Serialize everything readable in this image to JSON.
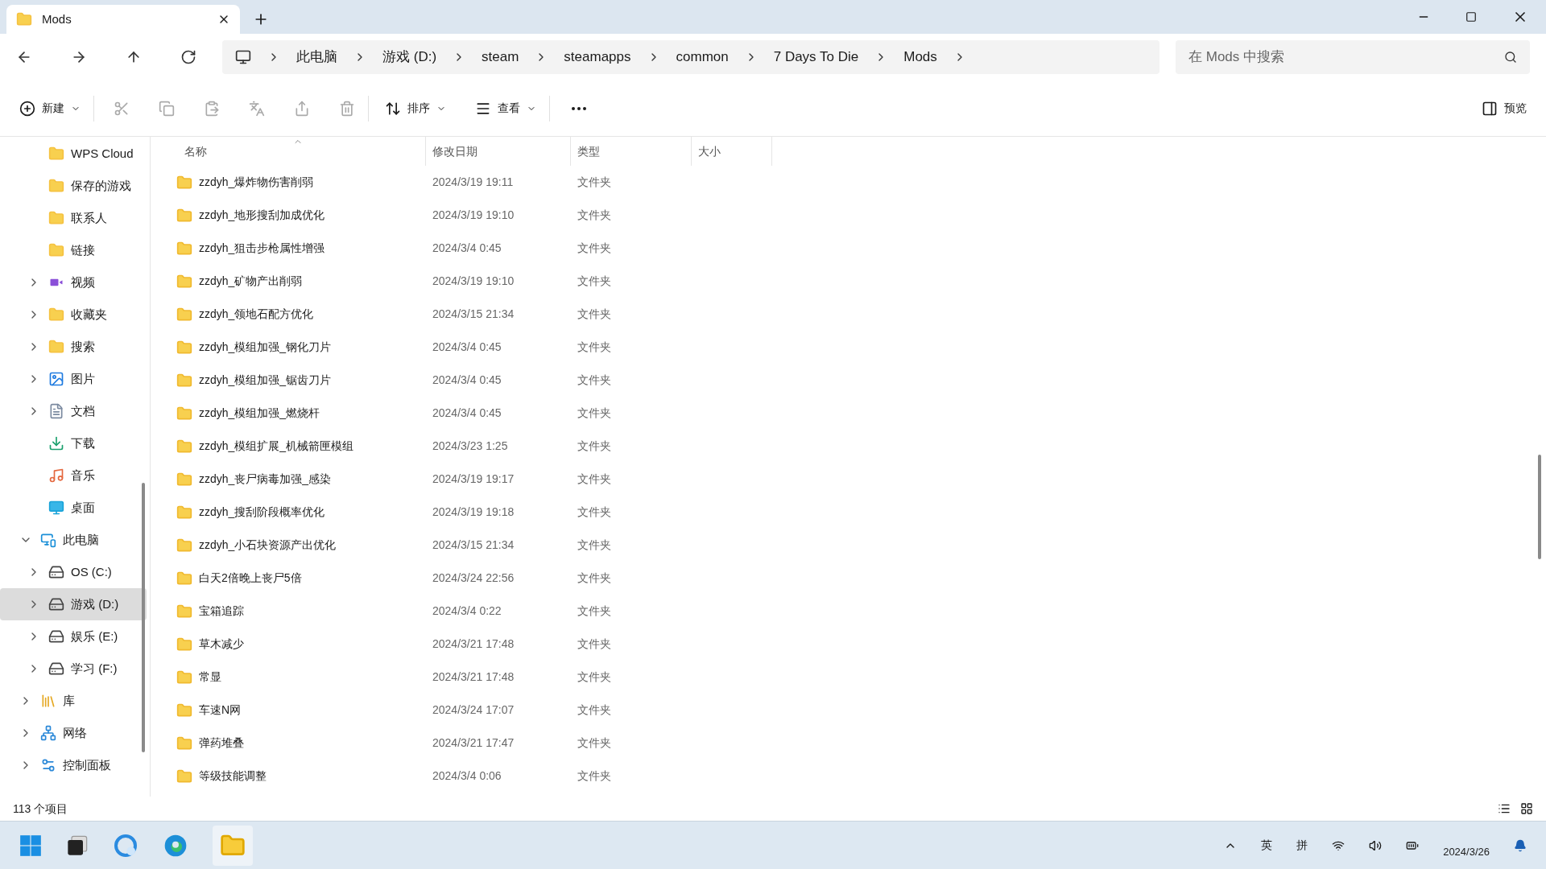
{
  "window": {
    "tab_title": "Mods"
  },
  "address": {
    "crumbs": [
      "此电脑",
      "游戏 (D:)",
      "steam",
      "steamapps",
      "common",
      "7 Days To Die",
      "Mods"
    ],
    "search_placeholder": "在 Mods 中搜索"
  },
  "toolbar": {
    "new": "新建",
    "sort": "排序",
    "view": "查看",
    "preview": "预览"
  },
  "sidebar": {
    "items": [
      {
        "label": "WPS Cloud",
        "kind": "folder",
        "selected": false
      },
      {
        "label": "保存的游戏",
        "kind": "folder",
        "selected": false
      },
      {
        "label": "联系人",
        "kind": "folder",
        "selected": false
      },
      {
        "label": "链接",
        "kind": "folder",
        "selected": false
      },
      {
        "label": "视频",
        "kind": "video",
        "selected": false,
        "expanded": false
      },
      {
        "label": "收藏夹",
        "kind": "folder",
        "selected": false,
        "expanded": false
      },
      {
        "label": "搜索",
        "kind": "folder",
        "selected": false,
        "expanded": false
      },
      {
        "label": "图片",
        "kind": "image",
        "selected": false,
        "expanded": false
      },
      {
        "label": "文档",
        "kind": "doc",
        "selected": false,
        "expanded": false
      },
      {
        "label": "下载",
        "kind": "download",
        "selected": false
      },
      {
        "label": "音乐",
        "kind": "music",
        "selected": false
      },
      {
        "label": "桌面",
        "kind": "desktop",
        "selected": false
      }
    ],
    "tree": [
      {
        "label": "此电脑",
        "kind": "pc",
        "selected": false,
        "expanded": true,
        "children": [
          {
            "label": "OS (C:)",
            "kind": "drive",
            "selected": false,
            "expanded": false
          },
          {
            "label": "游戏 (D:)",
            "kind": "drive",
            "selected": true,
            "expanded": false
          },
          {
            "label": "娱乐 (E:)",
            "kind": "drive",
            "selected": false,
            "expanded": false
          },
          {
            "label": "学习 (F:)",
            "kind": "drive",
            "selected": false,
            "expanded": false
          }
        ]
      },
      {
        "label": "库",
        "kind": "library",
        "selected": false,
        "expanded": false
      },
      {
        "label": "网络",
        "kind": "network",
        "selected": false,
        "expanded": false
      },
      {
        "label": "控制面板",
        "kind": "control",
        "selected": false,
        "expanded": false
      }
    ]
  },
  "table": {
    "columns": [
      "名称",
      "修改日期",
      "类型",
      "大小"
    ],
    "rows": [
      {
        "name": "zzdyh_爆炸物伤害削弱",
        "date": "2024/3/19 19:11",
        "type": "文件夹"
      },
      {
        "name": "zzdyh_地形搜刮加成优化",
        "date": "2024/3/19 19:10",
        "type": "文件夹"
      },
      {
        "name": "zzdyh_狙击步枪属性增强",
        "date": "2024/3/4 0:45",
        "type": "文件夹"
      },
      {
        "name": "zzdyh_矿物产出削弱",
        "date": "2024/3/19 19:10",
        "type": "文件夹"
      },
      {
        "name": "zzdyh_领地石配方优化",
        "date": "2024/3/15 21:34",
        "type": "文件夹"
      },
      {
        "name": "zzdyh_模组加强_钢化刀片",
        "date": "2024/3/4 0:45",
        "type": "文件夹"
      },
      {
        "name": "zzdyh_模组加强_锯齿刀片",
        "date": "2024/3/4 0:45",
        "type": "文件夹"
      },
      {
        "name": "zzdyh_模组加强_燃烧杆",
        "date": "2024/3/4 0:45",
        "type": "文件夹"
      },
      {
        "name": "zzdyh_模组扩展_机械箭匣模组",
        "date": "2024/3/23 1:25",
        "type": "文件夹"
      },
      {
        "name": "zzdyh_丧尸病毒加强_感染",
        "date": "2024/3/19 19:17",
        "type": "文件夹"
      },
      {
        "name": "zzdyh_搜刮阶段概率优化",
        "date": "2024/3/19 19:18",
        "type": "文件夹"
      },
      {
        "name": "zzdyh_小石块资源产出优化",
        "date": "2024/3/15 21:34",
        "type": "文件夹"
      },
      {
        "name": "白天2倍晚上丧尸5倍",
        "date": "2024/3/24 22:56",
        "type": "文件夹"
      },
      {
        "name": "宝箱追踪",
        "date": "2024/3/4 0:22",
        "type": "文件夹"
      },
      {
        "name": "草木减少",
        "date": "2024/3/21 17:48",
        "type": "文件夹"
      },
      {
        "name": "常显",
        "date": "2024/3/21 17:48",
        "type": "文件夹"
      },
      {
        "name": "车速N网",
        "date": "2024/3/24 17:07",
        "type": "文件夹"
      },
      {
        "name": "弹药堆叠",
        "date": "2024/3/21 17:47",
        "type": "文件夹"
      },
      {
        "name": "等级技能调整",
        "date": "2024/3/4 0:06",
        "type": "文件夹"
      }
    ]
  },
  "status_bar": {
    "count": "113 个项目"
  },
  "taskbar": {
    "tray": [
      "英",
      "拼"
    ],
    "date": "2024/3/26"
  }
}
